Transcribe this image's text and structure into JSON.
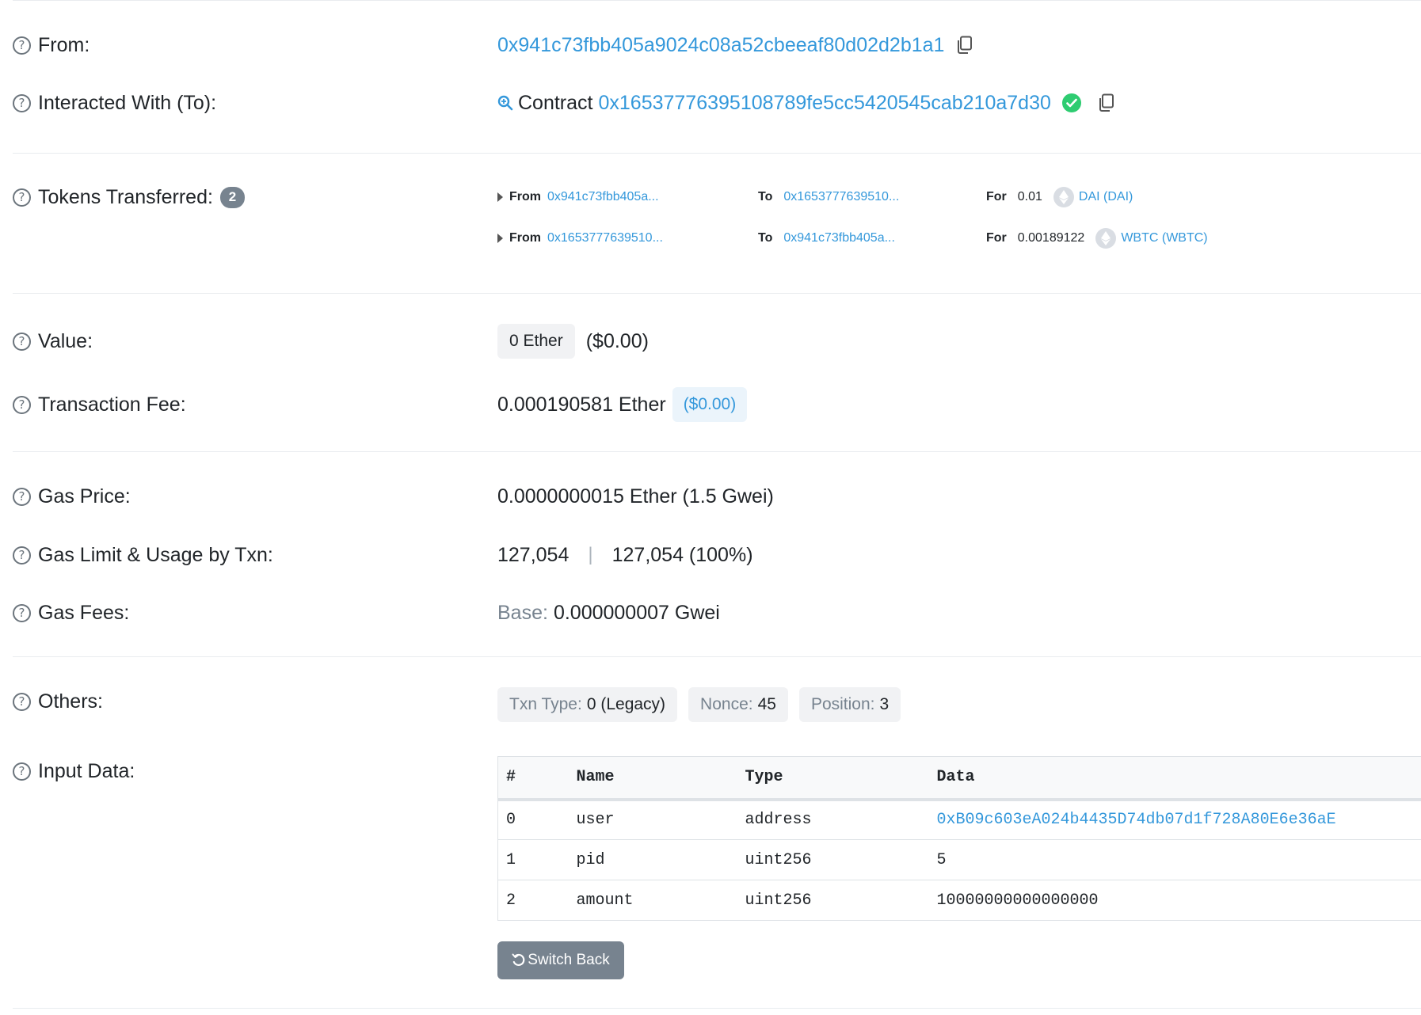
{
  "from": {
    "label": "From:",
    "address": "0x941c73fbb405a9024c08a52cbeeaf80d02d2b1a1"
  },
  "interacted": {
    "label": "Interacted With (To):",
    "prefix": "Contract",
    "address": "0x16537776395108789fe5cc5420545cab210a7d30"
  },
  "tokens": {
    "label": "Tokens Transferred:",
    "count": "2",
    "transfers": [
      {
        "from_label": "From",
        "from": "0x941c73fbb405a...",
        "to_label": "To",
        "to": "0x1653777639510...",
        "for_label": "For",
        "amount": "0.01",
        "token": "DAI (DAI)"
      },
      {
        "from_label": "From",
        "from": "0x1653777639510...",
        "to_label": "To",
        "to": "0x941c73fbb405a...",
        "for_label": "For",
        "amount": "0.00189122",
        "token": "WBTC (WBTC)"
      }
    ]
  },
  "value": {
    "label": "Value:",
    "amount": "0 Ether",
    "usd": "($0.00)"
  },
  "fee": {
    "label": "Transaction Fee:",
    "amount": "0.000190581 Ether",
    "usd": "($0.00)"
  },
  "gas_price": {
    "label": "Gas Price:",
    "value": "0.0000000015 Ether (1.5 Gwei)"
  },
  "gas_limit": {
    "label": "Gas Limit & Usage by Txn:",
    "limit": "127,054",
    "separator": "|",
    "usage": "127,054 (100%)"
  },
  "gas_fees": {
    "label": "Gas Fees:",
    "base_label": "Base:",
    "base_value": "0.000000007 Gwei"
  },
  "others": {
    "label": "Others:",
    "txn_type_label": "Txn Type:",
    "txn_type_value": "0 (Legacy)",
    "nonce_label": "Nonce:",
    "nonce_value": "45",
    "position_label": "Position:",
    "position_value": "3"
  },
  "input_data": {
    "label": "Input Data:",
    "headers": [
      "#",
      "Name",
      "Type",
      "Data"
    ],
    "rows": [
      {
        "index": "0",
        "name": "user",
        "type": "address",
        "data": "0xB09c603eA024b4435D74db07d1f728A80E6e36aE"
      },
      {
        "index": "1",
        "name": "pid",
        "type": "uint256",
        "data": "5"
      },
      {
        "index": "2",
        "name": "amount",
        "type": "uint256",
        "data": "10000000000000000"
      }
    ],
    "switch_label": "Switch Back"
  },
  "colors": {
    "link": "#3498db",
    "verified": "#2ecc71",
    "badge": "#77838f"
  }
}
